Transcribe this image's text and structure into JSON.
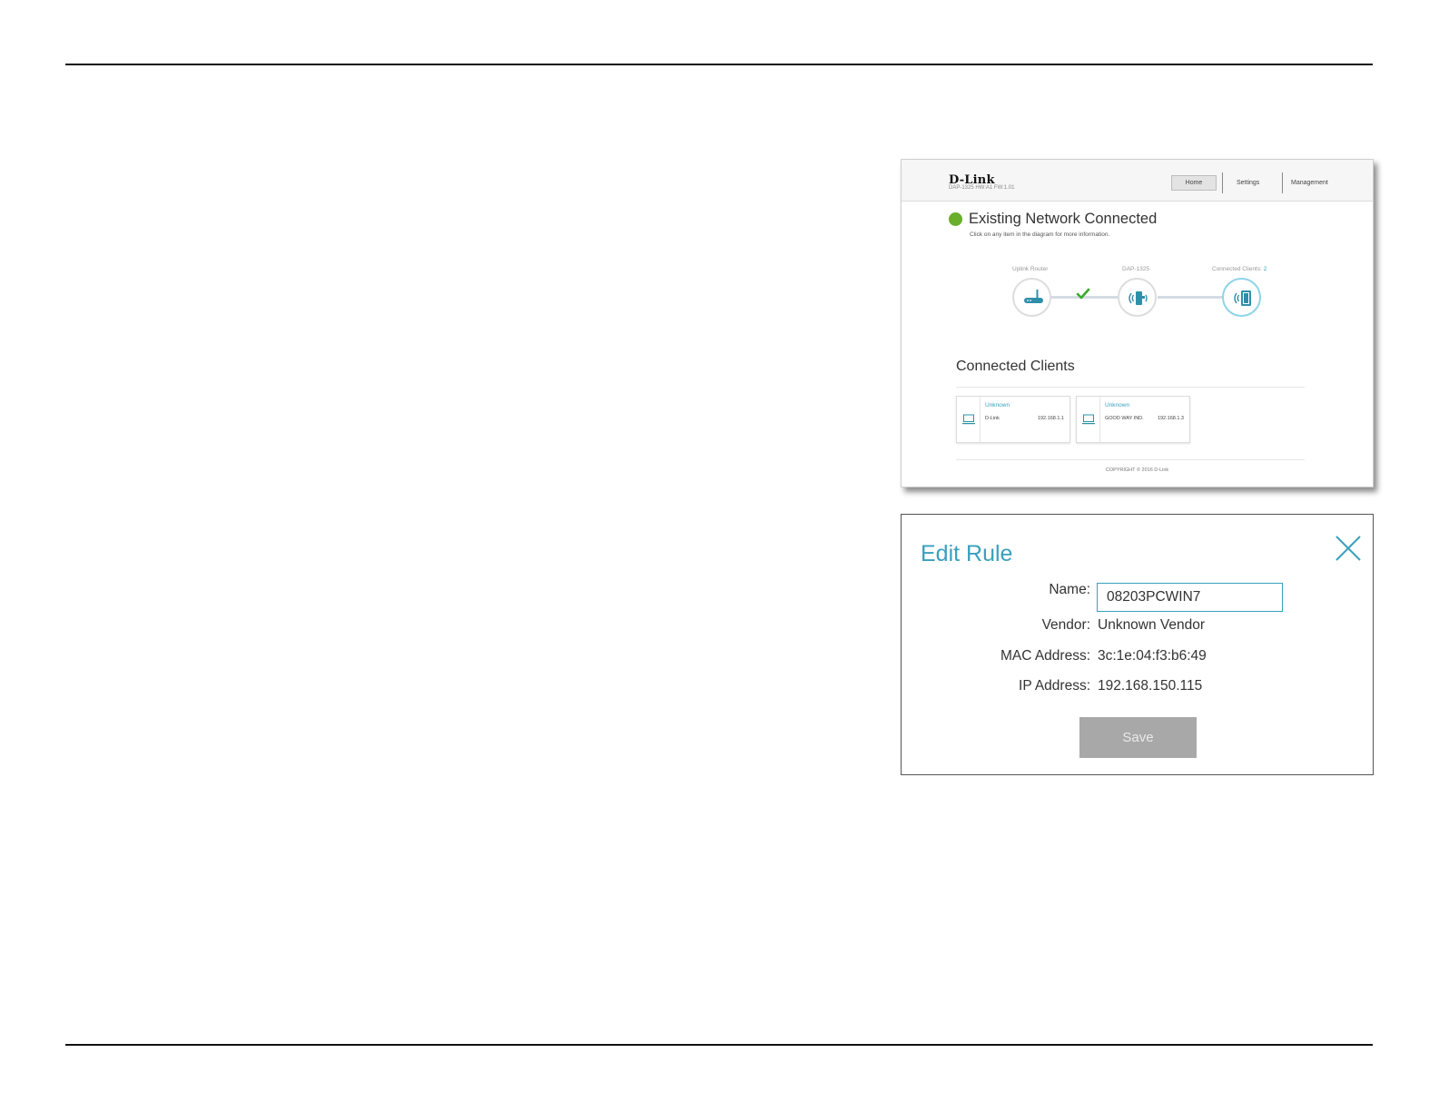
{
  "router_ui": {
    "brand": "D-Link",
    "firmware": "DAP-1325   HW:A1   FW:1.01",
    "nav": {
      "home": "Home",
      "settings": "Settings",
      "management": "Management"
    },
    "status": {
      "title": "Existing Network Connected",
      "subtitle": "Click on any item in the diagram for more information."
    },
    "diagram": {
      "uplink_label": "Uplink Router",
      "device_label": "DAP-1325",
      "clients_label": "Connected Clients:",
      "clients_count": "2"
    },
    "connected_clients": {
      "title": "Connected Clients",
      "clients": [
        {
          "type": "Unknown",
          "name": "D-Link",
          "ip": "192.168.1.1"
        },
        {
          "type": "Unknown",
          "name": "GOOD WAY IND.",
          "ip": "192.168.1.3"
        }
      ]
    },
    "copyright": "COPYRIGHT © 2016 D-Link",
    "colors": {
      "accent": "#3aa0bd",
      "status_green": "#6aae2b",
      "check_green": "#3bab2b"
    }
  },
  "edit_rule": {
    "title": "Edit Rule",
    "name_label": "Name:",
    "name_value": "08203PCWIN7",
    "vendor_label": "Vendor:",
    "vendor_value": "Unknown Vendor",
    "mac_label": "MAC Address:",
    "mac_value": "3c:1e:04:f3:b6:49",
    "ip_label": "IP Address:",
    "ip_value": "192.168.150.115",
    "save_label": "Save",
    "close_icon": "close-icon"
  }
}
